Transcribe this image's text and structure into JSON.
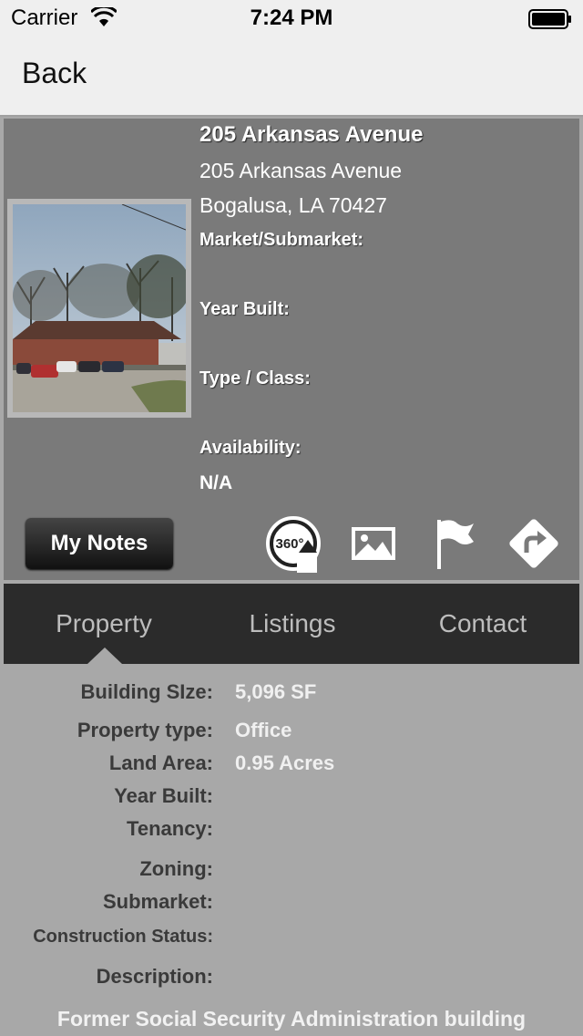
{
  "status_bar": {
    "carrier": "Carrier",
    "time": "7:24 PM"
  },
  "nav": {
    "back_label": "Back"
  },
  "property_summary": {
    "title": "205 Arkansas Avenue",
    "address_line1": "205 Arkansas Avenue",
    "address_line2": "Bogalusa, LA 70427",
    "market_label": "Market/Submarket:",
    "year_built_label": "Year Built:",
    "type_class_label": "Type / Class:",
    "availability_label": "Availability:",
    "availability_value": "N/A"
  },
  "actions": {
    "my_notes_label": "My Notes",
    "view_360_text": "360°",
    "icons": [
      "view-360-icon",
      "photo-gallery-icon",
      "flag-icon",
      "directions-icon"
    ]
  },
  "tabs": [
    {
      "label": "Property"
    },
    {
      "label": "Listings"
    },
    {
      "label": "Contact"
    }
  ],
  "details": [
    {
      "label": "Building SIze:",
      "value": "5,096 SF"
    },
    {
      "label": "Property type:",
      "value": "Office"
    },
    {
      "label": "Land Area:",
      "value": "0.95 Acres"
    },
    {
      "label": "Year Built:",
      "value": ""
    },
    {
      "label": "Tenancy:",
      "value": ""
    },
    {
      "label": "Zoning:",
      "value": ""
    },
    {
      "label": "Submarket:",
      "value": ""
    },
    {
      "label": "Construction Status:",
      "value": ""
    },
    {
      "label": "Description:",
      "value": ""
    }
  ],
  "description_text": "Former Social Security Administration building",
  "colors": {
    "nav_background": "#efefef",
    "summary_background": "#7a7a7a",
    "tab_bar_background": "#2b2b2b",
    "details_background": "#a8a8a8"
  }
}
